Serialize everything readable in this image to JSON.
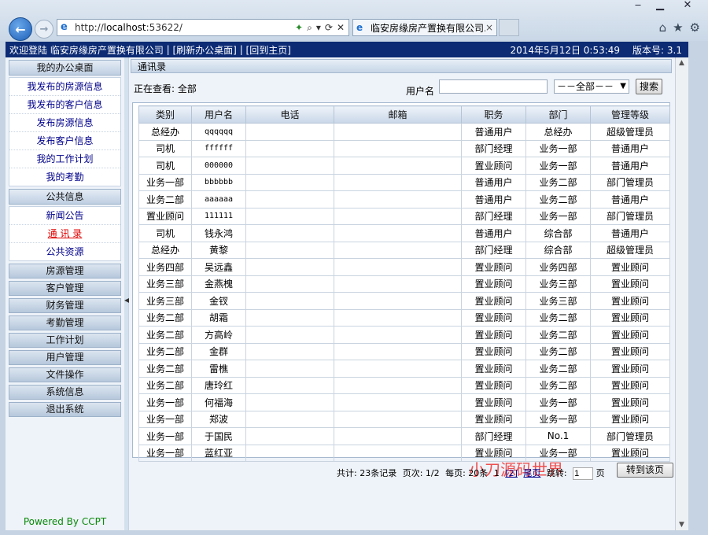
{
  "browser": {
    "window_controls": [
      "‒",
      "▁",
      "✕"
    ],
    "address_prefix": "http://",
    "address_host": "localhost",
    "address_rest": ":53622/",
    "tab_title": "临安房缘房产置换有限公司...",
    "tab_close": "×",
    "toolbar_glyphs": [
      "⌕",
      "▾",
      "⟳",
      "✕"
    ],
    "right_icons": [
      "⌂",
      "★",
      "⚙"
    ]
  },
  "header": {
    "welcome": "欢迎登陆  临安房缘房产置换有限公司",
    "refresh_link": "[刷新办公桌面]",
    "home_link": "[回到主页]",
    "datetime": "2014年5月12日  0:53:49",
    "version": "版本号: 3.1"
  },
  "sidebar": {
    "section1": "我的办公桌面",
    "items1": [
      "我发布的房源信息",
      "我发布的客户信息",
      "发布房源信息",
      "发布客户信息",
      "我的工作计划",
      "我的考勤"
    ],
    "section2": "公共信息",
    "items2": [
      "新闻公告",
      "通 讯 录",
      "公共资源"
    ],
    "buttons": [
      "房源管理",
      "客户管理",
      "财务管理",
      "考勤管理",
      "工作计划",
      "用户管理",
      "文件操作",
      "系统信息",
      "退出系统"
    ],
    "powered": "Powered By CCPT"
  },
  "main": {
    "title": "通讯录",
    "viewing": "正在查看: 全部",
    "username_label": "用户名",
    "username_value": "",
    "dept_select": "－－全部－－",
    "search_button": "搜索"
  },
  "table": {
    "headers": [
      "类别",
      "用户名",
      "电话",
      "邮箱",
      "职务",
      "部门",
      "管理等级"
    ],
    "rows": [
      [
        "总经办",
        "qqqqqq",
        "",
        "",
        "普通用户",
        "总经办",
        "超级管理员"
      ],
      [
        "司机",
        "ffffff",
        "",
        "",
        "部门经理",
        "业务一部",
        "普通用户"
      ],
      [
        "司机",
        "000000",
        "",
        "",
        "置业顾问",
        "业务一部",
        "普通用户"
      ],
      [
        "业务一部",
        "bbbbbb",
        "",
        "",
        "普通用户",
        "业务二部",
        "部门管理员"
      ],
      [
        "业务二部",
        "aaaaaa",
        "",
        "",
        "普通用户",
        "业务二部",
        "普通用户"
      ],
      [
        "置业顾问",
        "111111",
        "",
        "",
        "部门经理",
        "业务一部",
        "部门管理员"
      ],
      [
        "司机",
        "钱永鸿",
        "",
        "",
        "普通用户",
        "综合部",
        "普通用户"
      ],
      [
        "总经办",
        "黄黎",
        "",
        "",
        "部门经理",
        "综合部",
        "超级管理员"
      ],
      [
        "业务四部",
        "吴远鑫",
        "",
        "",
        "置业顾问",
        "业务四部",
        "置业顾问"
      ],
      [
        "业务三部",
        "金燕槐",
        "",
        "",
        "置业顾问",
        "业务三部",
        "置业顾问"
      ],
      [
        "业务三部",
        "金钗",
        "",
        "",
        "置业顾问",
        "业务三部",
        "置业顾问"
      ],
      [
        "业务二部",
        "胡霜",
        "",
        "",
        "置业顾问",
        "业务二部",
        "置业顾问"
      ],
      [
        "业务二部",
        "方高岭",
        "",
        "",
        "置业顾问",
        "业务二部",
        "置业顾问"
      ],
      [
        "业务二部",
        "金群",
        "",
        "",
        "置业顾问",
        "业务二部",
        "置业顾问"
      ],
      [
        "业务二部",
        "雷樵",
        "",
        "",
        "置业顾问",
        "业务二部",
        "置业顾问"
      ],
      [
        "业务二部",
        "唐玲红",
        "",
        "",
        "置业顾问",
        "业务二部",
        "置业顾问"
      ],
      [
        "业务一部",
        "何福海",
        "",
        "",
        "置业顾问",
        "业务一部",
        "置业顾问"
      ],
      [
        "业务一部",
        "郑波",
        "",
        "",
        "置业顾问",
        "业务一部",
        "置业顾问"
      ],
      [
        "业务一部",
        "于国民",
        "",
        "",
        "部门经理",
        "No.1",
        "部门管理员"
      ],
      [
        "业务一部",
        "蓝红亚",
        "",
        "",
        "置业顾问",
        "业务一部",
        "置业顾问"
      ]
    ]
  },
  "pager": {
    "total": "共计: 23条记录",
    "page": "页次: 1/2",
    "per_page": "每页: 20条",
    "first": "1",
    "second": "[2]",
    "last": "尾页",
    "jump_label": "跳转:",
    "jump_value": "1",
    "jump_unit": "页",
    "jump_button": "转到该页"
  },
  "watermark": "小刀源码世界"
}
